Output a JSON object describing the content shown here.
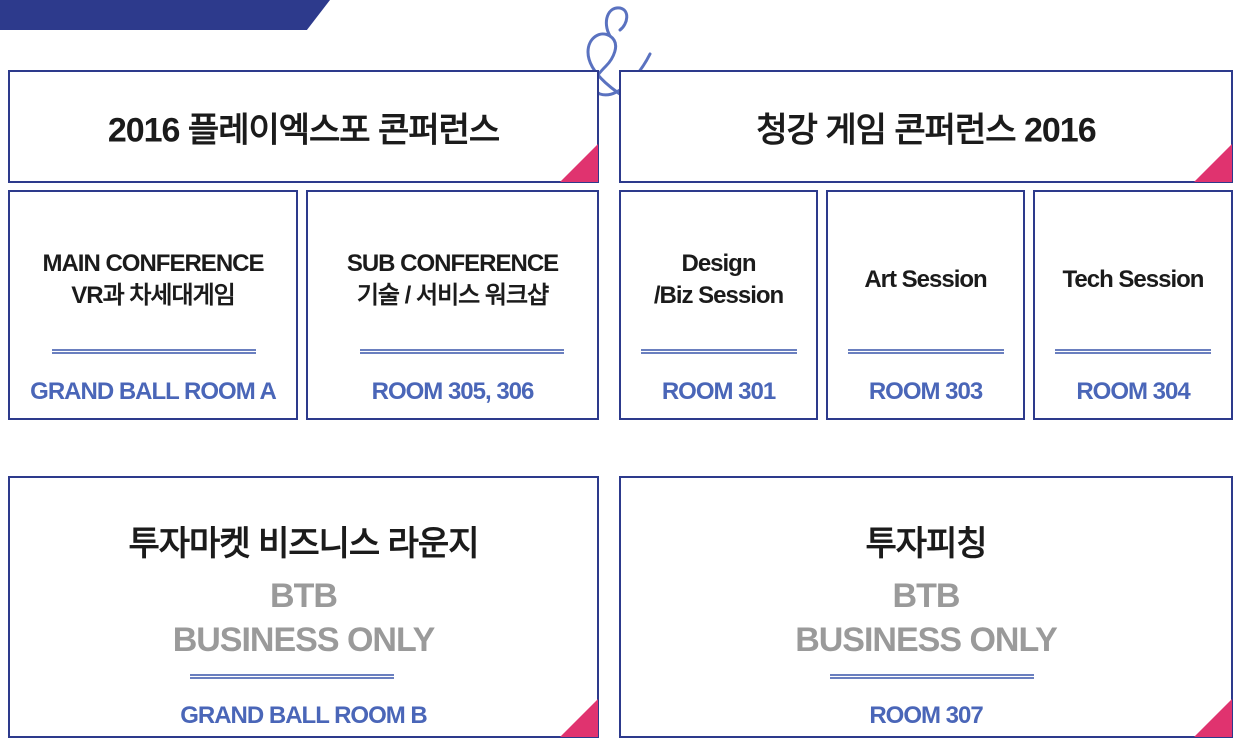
{
  "colors": {
    "navy": "#2d3a8c",
    "accent_pink": "#e0336f",
    "room_blue": "#4a66b8",
    "gray_text": "#9a9a9a"
  },
  "ampersand": "&",
  "headers": {
    "playexpo": "2016 플레이엑스포 콘퍼런스",
    "cheonggang": "청강 게임 콘퍼런스 2016"
  },
  "sessions": [
    {
      "line1": "MAIN CONFERENCE",
      "line2": "VR과 차세대게임",
      "room": "GRAND BALL ROOM  A"
    },
    {
      "line1": "SUB CONFERENCE",
      "line2": "기술 / 서비스 워크샵",
      "room": "ROOM 305, 306"
    },
    {
      "line1": "Design",
      "line2": "/Biz Session",
      "room": "ROOM 301"
    },
    {
      "line1": "Art Session",
      "line2": "",
      "room": "ROOM 303"
    },
    {
      "line1": "Tech Session",
      "line2": "",
      "room": "ROOM 304"
    }
  ],
  "lower": [
    {
      "title": "투자마켓  비즈니스 라운지",
      "line1": "BTB",
      "line2": "BUSINESS ONLY",
      "room": "GRAND BALL ROOM  B"
    },
    {
      "title": "투자피칭",
      "line1": "BTB",
      "line2": "BUSINESS ONLY",
      "room": "ROOM  307"
    }
  ]
}
